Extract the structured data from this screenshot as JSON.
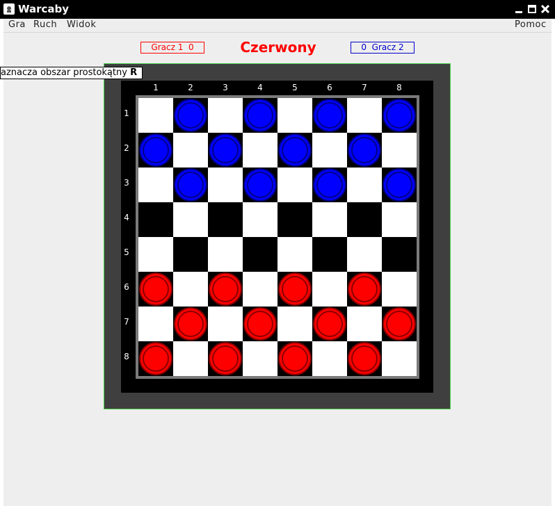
{
  "window": {
    "title": "Warcaby"
  },
  "menu": {
    "items": [
      "Gra",
      "Ruch",
      "Widok"
    ],
    "help": "Pomoc"
  },
  "score": {
    "player1_label": "Gracz 1",
    "player1_score": "0",
    "player2_label": "Gracz 2",
    "player2_score": "0",
    "player1_color": "#ff0000",
    "player2_color": "#0000cc"
  },
  "turn": {
    "text": "Czerwony",
    "color": "#ff0000"
  },
  "tooltip": {
    "text": "aznacza obszar prostokątny",
    "shortcut": "R"
  },
  "board": {
    "columns": [
      "1",
      "2",
      "3",
      "4",
      "5",
      "6",
      "7",
      "8"
    ],
    "rows": [
      "1",
      "2",
      "3",
      "4",
      "5",
      "6",
      "7",
      "8"
    ],
    "colors": {
      "light": "#ffffff",
      "dark": "#000000",
      "blue_piece": "#0000ff",
      "red_piece": "#ff0000"
    },
    "pieces": [
      [
        "",
        "blue",
        "",
        "blue",
        "",
        "blue",
        "",
        "blue"
      ],
      [
        "blue",
        "",
        "blue",
        "",
        "blue",
        "",
        "blue",
        ""
      ],
      [
        "",
        "blue",
        "",
        "blue",
        "",
        "blue",
        "",
        "blue"
      ],
      [
        "",
        "",
        "",
        "",
        "",
        "",
        "",
        ""
      ],
      [
        "",
        "",
        "",
        "",
        "",
        "",
        "",
        ""
      ],
      [
        "red",
        "",
        "red",
        "",
        "red",
        "",
        "red",
        ""
      ],
      [
        "",
        "red",
        "",
        "red",
        "",
        "red",
        "",
        "red"
      ],
      [
        "red",
        "",
        "red",
        "",
        "red",
        "",
        "red",
        ""
      ]
    ]
  }
}
